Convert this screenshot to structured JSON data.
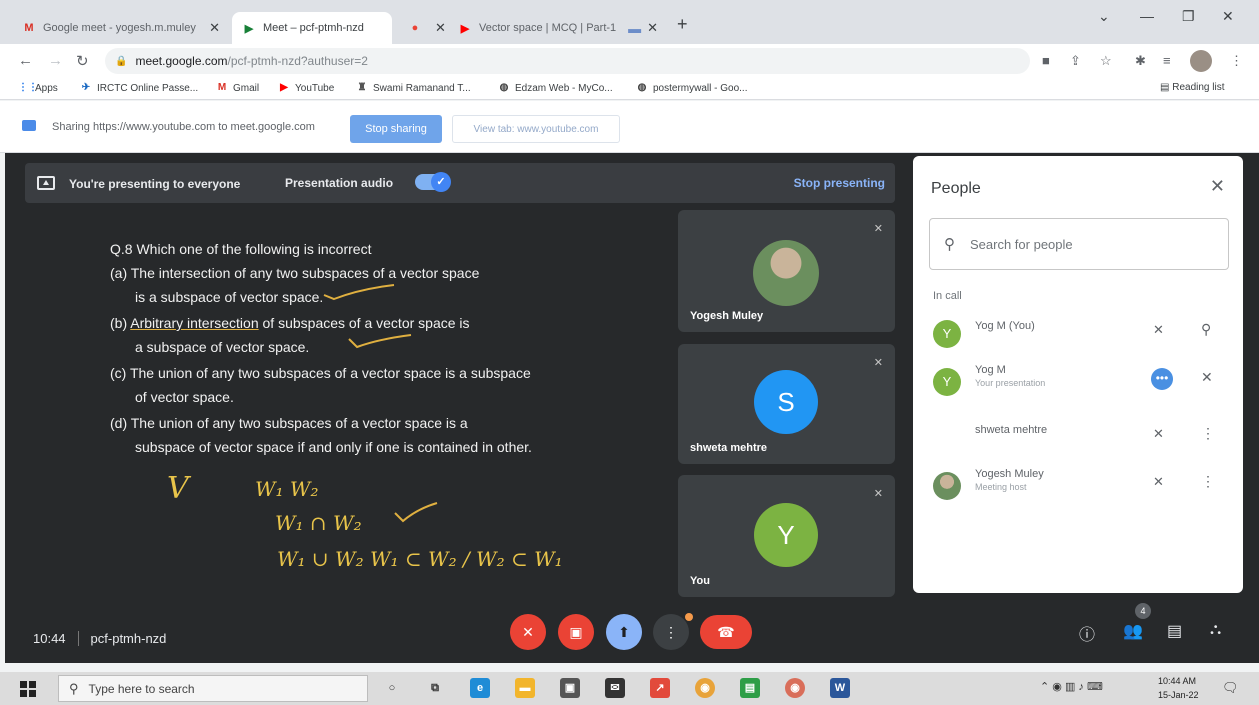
{
  "browser": {
    "tabs": [
      {
        "title": "Google meet - yogesh.m.muley",
        "favicon_color": "#d93025",
        "favicon_text": "M"
      },
      {
        "title": "Meet – pcf-ptmh-nzd",
        "favicon_color": "#188038",
        "favicon_text": "▶"
      },
      {
        "title": "",
        "favicon_color": "#ea4335",
        "favicon_text": "●"
      },
      {
        "title": "Vector space | MCQ | Part-1",
        "favicon_color": "#ff0000",
        "favicon_text": "▶"
      }
    ],
    "url_host": "meet.google.com",
    "url_path": "/pcf-ptmh-nzd?authuser=2",
    "bookmarks": [
      {
        "label": "Apps",
        "icon": "apps-grid-icon"
      },
      {
        "label": "IRCTC Online Passe...",
        "icon": "irctc-icon"
      },
      {
        "label": "Gmail",
        "icon": "gmail-icon"
      },
      {
        "label": "YouTube",
        "icon": "youtube-icon"
      },
      {
        "label": "Swami Ramanand T...",
        "icon": "university-icon"
      },
      {
        "label": "Edzam Web - MyCo...",
        "icon": "globe-icon"
      },
      {
        "label": "postermywall - Goo...",
        "icon": "globe-icon"
      }
    ],
    "reading_list": "Reading list"
  },
  "infobar": {
    "message": "Sharing https://www.youtube.com to meet.google.com",
    "stop_sharing": "Stop sharing",
    "view_tab": "View tab: www.youtube.com"
  },
  "presbar": {
    "presenting_text": "You're presenting to everyone",
    "audio_label": "Presentation audio",
    "stop_presenting": "Stop presenting"
  },
  "slide": {
    "question": "Q.8 Which one of the following is incorrect",
    "a1": "(a) The intersection of any two subspaces of a vector space",
    "a2": "is a subspace of vector space.",
    "b1_ul": "Arbitrary intersection",
    "b1_pre": "(b) ",
    "b1_post": " of subspaces of a vector space is",
    "b2": "a subspace of vector space.",
    "c1": "(c) The union of any two subspaces of a vector space is a subspace",
    "c2": "of vector space.",
    "d1": "(d) The union of any two subspaces of a vector space is a",
    "d2": "subspace of vector space if and only if one is contained in other.",
    "hw_v": "V",
    "hw_w": "W₁    W₂",
    "hw_int": "W₁ ∩ W₂",
    "hw_union": "W₁ ∪ W₂     W₁ ⊂ W₂ / W₂ ⊂ W₁"
  },
  "tiles": [
    {
      "name": "Yogesh Muley",
      "avatar_letter": "",
      "avatar_color": "#8a7a6a"
    },
    {
      "name": "shweta mehtre",
      "avatar_letter": "S",
      "avatar_color": "#2196f3"
    },
    {
      "name": "You",
      "avatar_letter": "Y",
      "avatar_color": "#7cb342"
    }
  ],
  "people_panel": {
    "title": "People",
    "search_placeholder": "Search for people",
    "section": "In call",
    "participants": [
      {
        "name": "Yog M (You)",
        "sub": "",
        "avatar_letter": "Y",
        "avatar_color": "#7cb342"
      },
      {
        "name": "Yog M",
        "sub": "Your presentation",
        "avatar_letter": "Y",
        "avatar_color": "#7cb342"
      },
      {
        "name": "shweta mehtre",
        "sub": "",
        "avatar_letter": "",
        "avatar_color": "#ffffff"
      },
      {
        "name": "Yogesh Muley",
        "sub": "Meeting host",
        "avatar_letter": "",
        "avatar_color": "#8a7a6a"
      }
    ]
  },
  "meeting": {
    "time": "10:44",
    "code": "pcf-ptmh-nzd",
    "people_count": "4"
  },
  "taskbar": {
    "search_placeholder": "Type here to search",
    "time": "10:44 AM",
    "date": "15-Jan-22"
  }
}
